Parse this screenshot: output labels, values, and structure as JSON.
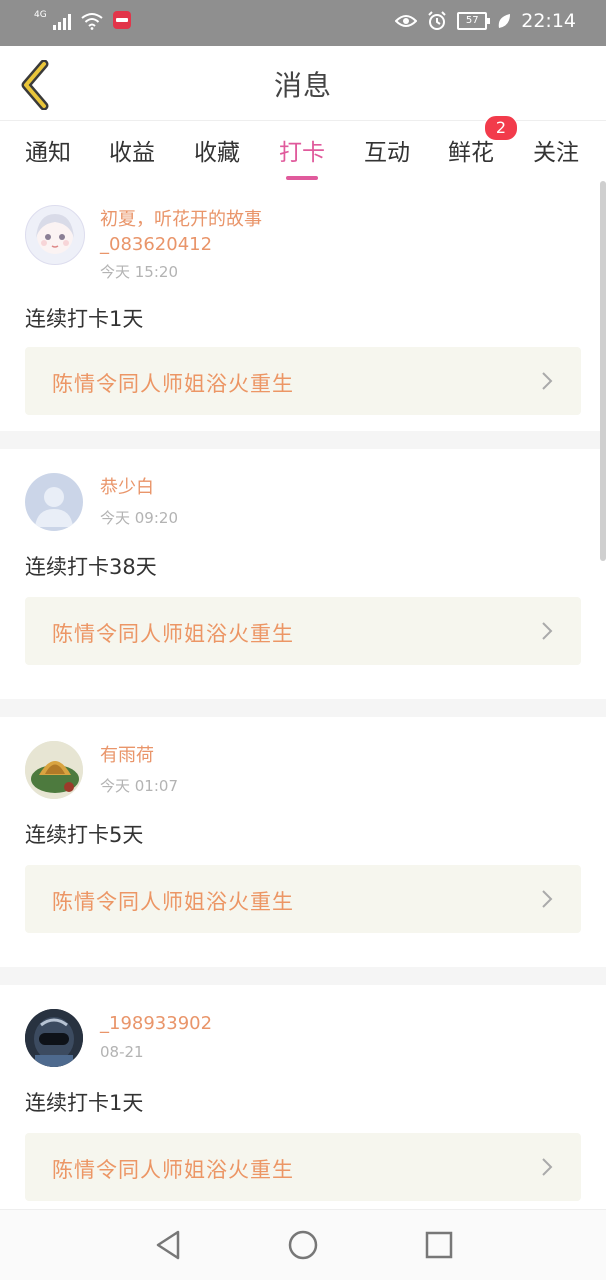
{
  "status_bar": {
    "network": "4G",
    "battery": "57",
    "time": "22:14"
  },
  "header": {
    "title": "消息"
  },
  "tabs": [
    {
      "label": "通知"
    },
    {
      "label": "收益"
    },
    {
      "label": "收藏"
    },
    {
      "label": "打卡",
      "active": true
    },
    {
      "label": "互动"
    },
    {
      "label": "鲜花",
      "badge": "2"
    },
    {
      "label": "关注"
    }
  ],
  "feed": [
    {
      "username": "初夏，听花开的故事_083620412",
      "time": "今天 15:20",
      "checkin": "连续打卡1天",
      "link": "陈情令同人师姐浴火重生"
    },
    {
      "username": "恭少白",
      "time": "今天 09:20",
      "checkin": "连续打卡38天",
      "link": "陈情令同人师姐浴火重生"
    },
    {
      "username": "有雨荷",
      "time": "今天 01:07",
      "checkin": "连续打卡5天",
      "link": "陈情令同人师姐浴火重生"
    },
    {
      "username": "_198933902",
      "time": "08-21",
      "checkin": "连续打卡1天",
      "link": "陈情令同人师姐浴火重生"
    }
  ],
  "colors": {
    "accent": "#e05a9c",
    "username": "#e9956a",
    "link_text": "#ec9665",
    "badge": "#f23b4b"
  }
}
